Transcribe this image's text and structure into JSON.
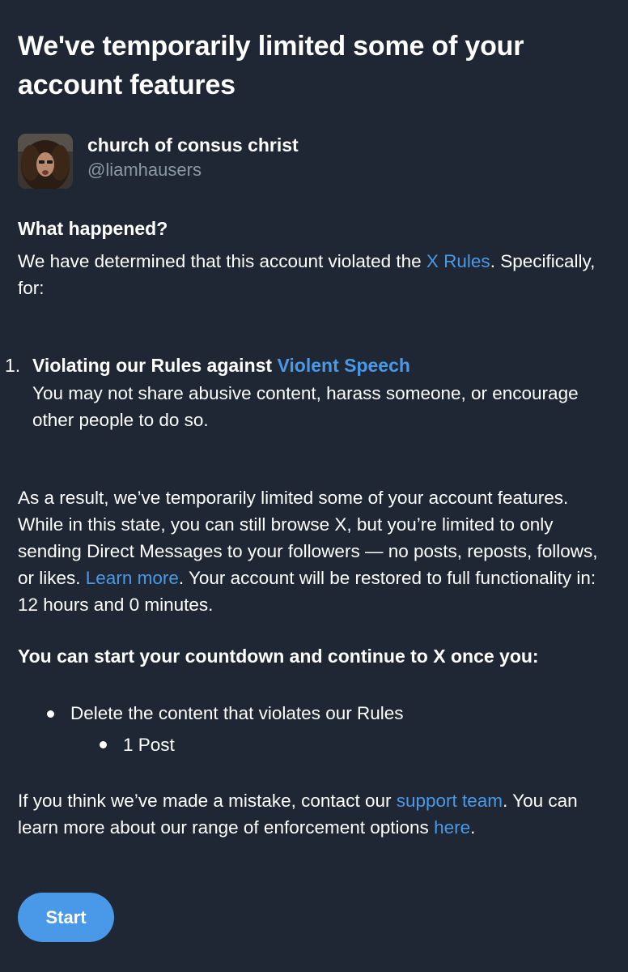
{
  "headline": "We've temporarily limited some of your account features",
  "account": {
    "display_name": "church of consus christ",
    "handle": "@liamhausers"
  },
  "what_happened": {
    "title": "What happened?",
    "text_before_link": "We have determined that this account violated the ",
    "rules_link": "X Rules",
    "text_after_link": ". Specifically, for:"
  },
  "violations": [
    {
      "number": "1.",
      "title_prefix": "Violating our Rules against ",
      "title_link": "Violent Speech",
      "description": "You may not share abusive content, harass someone, or encourage other people to do so."
    }
  ],
  "result": {
    "text_before_link": "As a result, we’ve temporarily limited some of your account features. While in this state, you can still browse X, but you’re limited to only sending Direct Messages to your followers — no posts, reposts, follows, or likes. ",
    "learn_more_link": "Learn more",
    "text_after_link": ". Your account will be restored to full functionality in: 12 hours and 0 minutes."
  },
  "conditions": {
    "title": "You can start your countdown and continue to X once you:",
    "item": "Delete the content that violates our Rules",
    "sub_item": "1 Post"
  },
  "footer": {
    "text_before_link": "If you think we’ve made a mistake, contact our ",
    "support_link": "support team",
    "text_middle": ". You can learn more about our range of enforcement options ",
    "here_link": "here",
    "text_end": "."
  },
  "start_button": "Start",
  "colors": {
    "background": "#1e2733",
    "link": "#4a99e9",
    "secondary_text": "#8b98a5",
    "button": "#4a99e9"
  }
}
